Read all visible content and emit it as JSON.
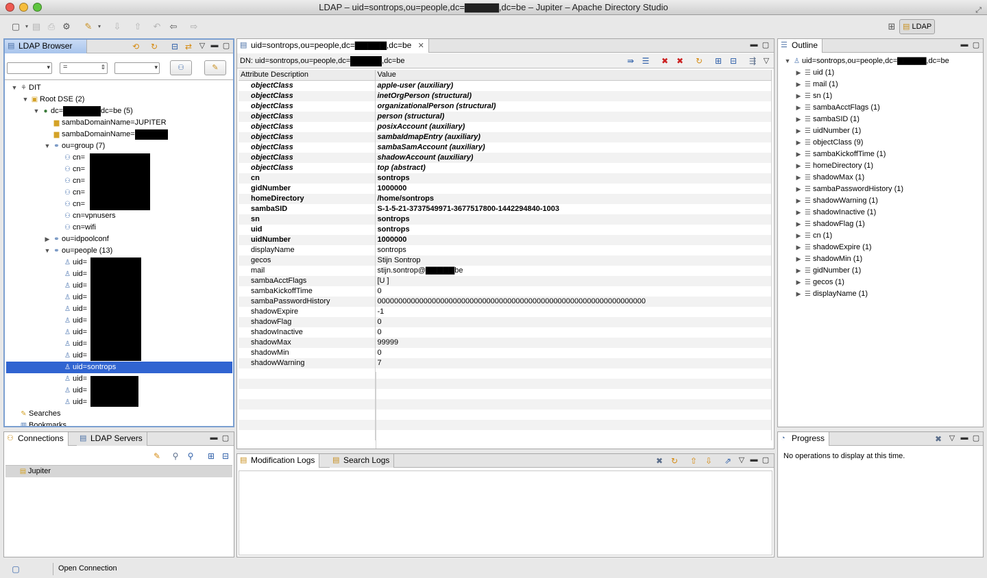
{
  "window": {
    "title": "LDAP – uid=sontrops,ou=people,dc=▇▇▇▇▇,dc=be – Jupiter – Apache Directory Studio"
  },
  "perspective": {
    "label": "LDAP"
  },
  "browser": {
    "tab_label": "LDAP Browser",
    "tree": [
      {
        "label": "DIT",
        "icon": "dit-icon"
      },
      {
        "label": "Root DSE (2)",
        "icon": "root-dse-icon"
      },
      {
        "label_pre": "dc=",
        "label_post": "dc=be (5)",
        "icon": "globe-icon"
      },
      {
        "label": "sambaDomainName=JUPITER",
        "icon": "folder-icon"
      },
      {
        "label": "sambaDomainName=",
        "icon": "folder-icon"
      },
      {
        "label": "ou=group (7)",
        "icon": "org-unit-icon"
      },
      {
        "label": "cn=",
        "icon": "group-icon"
      },
      {
        "label": "cn=",
        "icon": "group-icon"
      },
      {
        "label": "cn=",
        "icon": "group-icon"
      },
      {
        "label": "cn=",
        "icon": "group-icon"
      },
      {
        "label": "cn=",
        "icon": "group-icon"
      },
      {
        "label": "cn=vpnusers",
        "icon": "group-icon"
      },
      {
        "label": "cn=wifi",
        "icon": "group-icon"
      },
      {
        "label": "ou=idpoolconf",
        "icon": "org-unit-icon"
      },
      {
        "label": "ou=people (13)",
        "icon": "org-unit-icon"
      },
      {
        "label": "uid=",
        "icon": "person-icon"
      },
      {
        "label": "uid=",
        "icon": "person-icon"
      },
      {
        "label": "uid=",
        "icon": "person-icon"
      },
      {
        "label": "uid=",
        "icon": "person-icon"
      },
      {
        "label": "uid=",
        "icon": "person-icon"
      },
      {
        "label": "uid=",
        "icon": "person-icon"
      },
      {
        "label": "uid=",
        "icon": "person-icon"
      },
      {
        "label": "uid=",
        "icon": "person-icon"
      },
      {
        "label": "uid=",
        "icon": "person-icon"
      },
      {
        "label": "uid=sontrops",
        "icon": "person-icon"
      },
      {
        "label": "uid=",
        "icon": "person-icon"
      },
      {
        "label": "uid=",
        "icon": "person-icon"
      },
      {
        "label": "uid=",
        "icon": "person-icon"
      },
      {
        "label": "Searches",
        "icon": "searches-icon"
      },
      {
        "label": "Bookmarks",
        "icon": "bookmarks-icon"
      }
    ],
    "filter_op": "="
  },
  "connections": {
    "tab1": "Connections",
    "tab2": "LDAP Servers",
    "items": [
      "Jupiter"
    ]
  },
  "editor": {
    "tab_title": "uid=sontrops,ou=people,dc=▇▇▇▇▇,dc=be",
    "dn_prefix": "DN: uid=sontrops,ou=people,dc=",
    "dn_suffix": ",dc=be",
    "col_attr": "Attribute Description",
    "col_value": "Value",
    "rows": [
      {
        "attr": "objectClass",
        "value": "apple-user (auxiliary)",
        "style": "bi"
      },
      {
        "attr": "objectClass",
        "value": "inetOrgPerson (structural)",
        "style": "bi"
      },
      {
        "attr": "objectClass",
        "value": "organizationalPerson (structural)",
        "style": "bi"
      },
      {
        "attr": "objectClass",
        "value": "person (structural)",
        "style": "bi"
      },
      {
        "attr": "objectClass",
        "value": "posixAccount (auxiliary)",
        "style": "bi"
      },
      {
        "attr": "objectClass",
        "value": "sambaIdmapEntry (auxiliary)",
        "style": "bi"
      },
      {
        "attr": "objectClass",
        "value": "sambaSamAccount (auxiliary)",
        "style": "bi"
      },
      {
        "attr": "objectClass",
        "value": "shadowAccount (auxiliary)",
        "style": "bi"
      },
      {
        "attr": "objectClass",
        "value": "top (abstract)",
        "style": "bi"
      },
      {
        "attr": "cn",
        "value": "sontrops",
        "style": "b"
      },
      {
        "attr": "gidNumber",
        "value": "1000000",
        "style": "b"
      },
      {
        "attr": "homeDirectory",
        "value": "/home/sontrops",
        "style": "b"
      },
      {
        "attr": "sambaSID",
        "value": "S-1-5-21-3737549971-3677517800-1442294840-1003",
        "style": "b"
      },
      {
        "attr": "sn",
        "value": "sontrops",
        "style": "b"
      },
      {
        "attr": "uid",
        "value": "sontrops",
        "style": "b"
      },
      {
        "attr": "uidNumber",
        "value": "1000000",
        "style": "b"
      },
      {
        "attr": "displayName",
        "value": "sontrops",
        "style": ""
      },
      {
        "attr": "gecos",
        "value": "Stijn Sontrop",
        "style": ""
      },
      {
        "attr": "mail",
        "value": "stijn.sontrop@▇▇▇▇▇be",
        "style": ""
      },
      {
        "attr": "sambaAcctFlags",
        "value": "[U          ]",
        "style": ""
      },
      {
        "attr": "sambaKickoffTime",
        "value": "0",
        "style": ""
      },
      {
        "attr": "sambaPasswordHistory",
        "value": "0000000000000000000000000000000000000000000000000000000000000000",
        "style": ""
      },
      {
        "attr": "shadowExpire",
        "value": "-1",
        "style": ""
      },
      {
        "attr": "shadowFlag",
        "value": "0",
        "style": ""
      },
      {
        "attr": "shadowInactive",
        "value": "0",
        "style": ""
      },
      {
        "attr": "shadowMax",
        "value": "99999",
        "style": ""
      },
      {
        "attr": "shadowMin",
        "value": "0",
        "style": ""
      },
      {
        "attr": "shadowWarning",
        "value": "7",
        "style": ""
      }
    ]
  },
  "logs": {
    "tab1": "Modification Logs",
    "tab2": "Search Logs"
  },
  "outline": {
    "tab_label": "Outline",
    "root": "uid=sontrops,ou=people,dc=▇▇▇▇▇,dc=be",
    "items": [
      "uid (1)",
      "mail (1)",
      "sn (1)",
      "sambaAcctFlags (1)",
      "sambaSID (1)",
      "uidNumber (1)",
      "objectClass (9)",
      "sambaKickoffTime (1)",
      "homeDirectory (1)",
      "shadowMax (1)",
      "sambaPasswordHistory (1)",
      "shadowWarning (1)",
      "shadowInactive (1)",
      "shadowFlag (1)",
      "cn (1)",
      "shadowExpire (1)",
      "shadowMin (1)",
      "gidNumber (1)",
      "gecos (1)",
      "displayName (1)"
    ]
  },
  "progress": {
    "tab_label": "Progress",
    "message": "No operations to display at this time."
  },
  "status": {
    "text": "Open Connection"
  }
}
